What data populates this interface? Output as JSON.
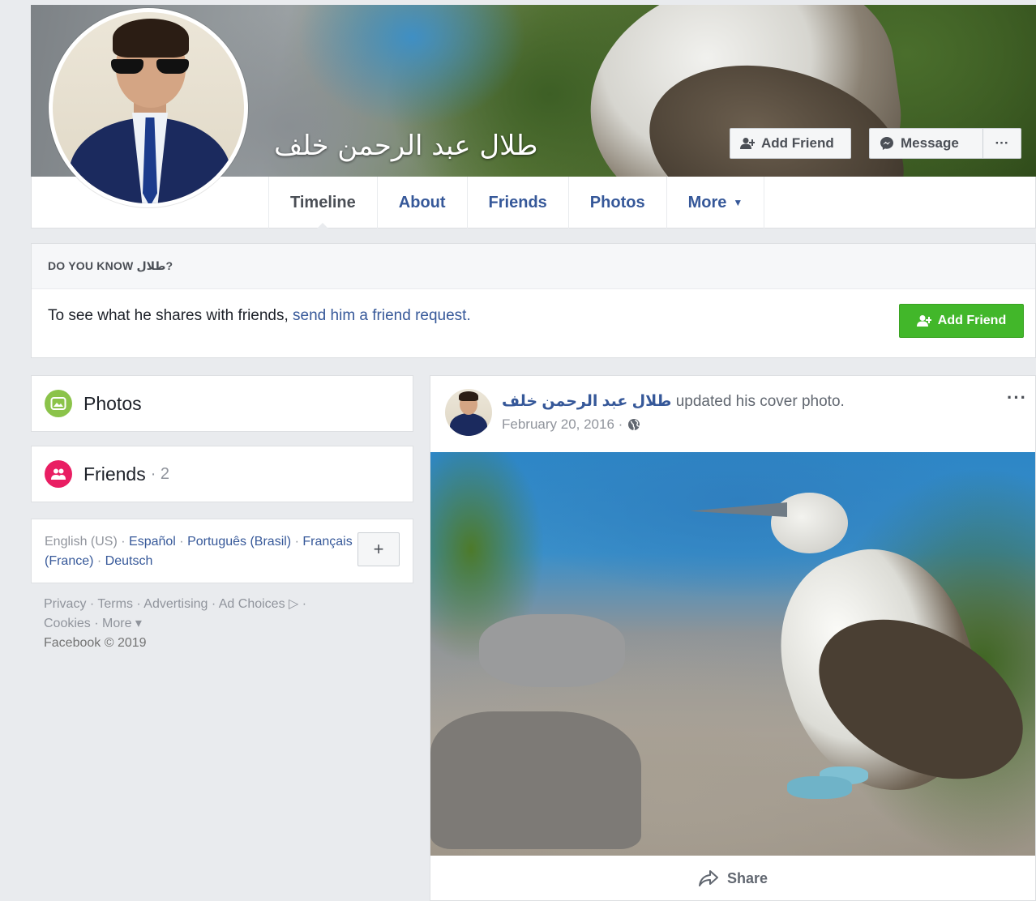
{
  "profile": {
    "name": "طلال عبد الرحمن خلف"
  },
  "cover_actions": {
    "add_friend": "Add Friend",
    "message": "Message",
    "more": "···"
  },
  "tabs": [
    {
      "label": "Timeline",
      "active": true
    },
    {
      "label": "About"
    },
    {
      "label": "Friends"
    },
    {
      "label": "Photos"
    },
    {
      "label": "More"
    }
  ],
  "do_you_know": {
    "heading": "DO YOU KNOW طلال?",
    "text": "To see what he shares with friends, ",
    "link": "send him a friend request.",
    "button": "Add Friend"
  },
  "sidebar": {
    "photos": {
      "title": "Photos",
      "icon": "photo-icon"
    },
    "friends": {
      "title": "Friends",
      "count": " · 2",
      "icon": "friends-icon"
    }
  },
  "languages": {
    "current": "English (US) · ",
    "links": [
      "Español",
      " · ",
      "Português (Brasil)",
      " · ",
      "Français (France)",
      " · ",
      "Deutsch"
    ],
    "add": "+"
  },
  "footer": {
    "line1": "Privacy · Terms · Advertising · Ad Choices ▷ ·",
    "line2": "Cookies · More ▾",
    "copyright": "Facebook © 2019"
  },
  "post": {
    "author": "طلال عبد الرحمن خلف",
    "action": " updated his cover photo.",
    "date": "February 20, 2016 · ",
    "menu": "···",
    "share": "Share"
  },
  "colors": {
    "link": "#365899",
    "green": "#42b72a",
    "background": "#e9ebee"
  }
}
